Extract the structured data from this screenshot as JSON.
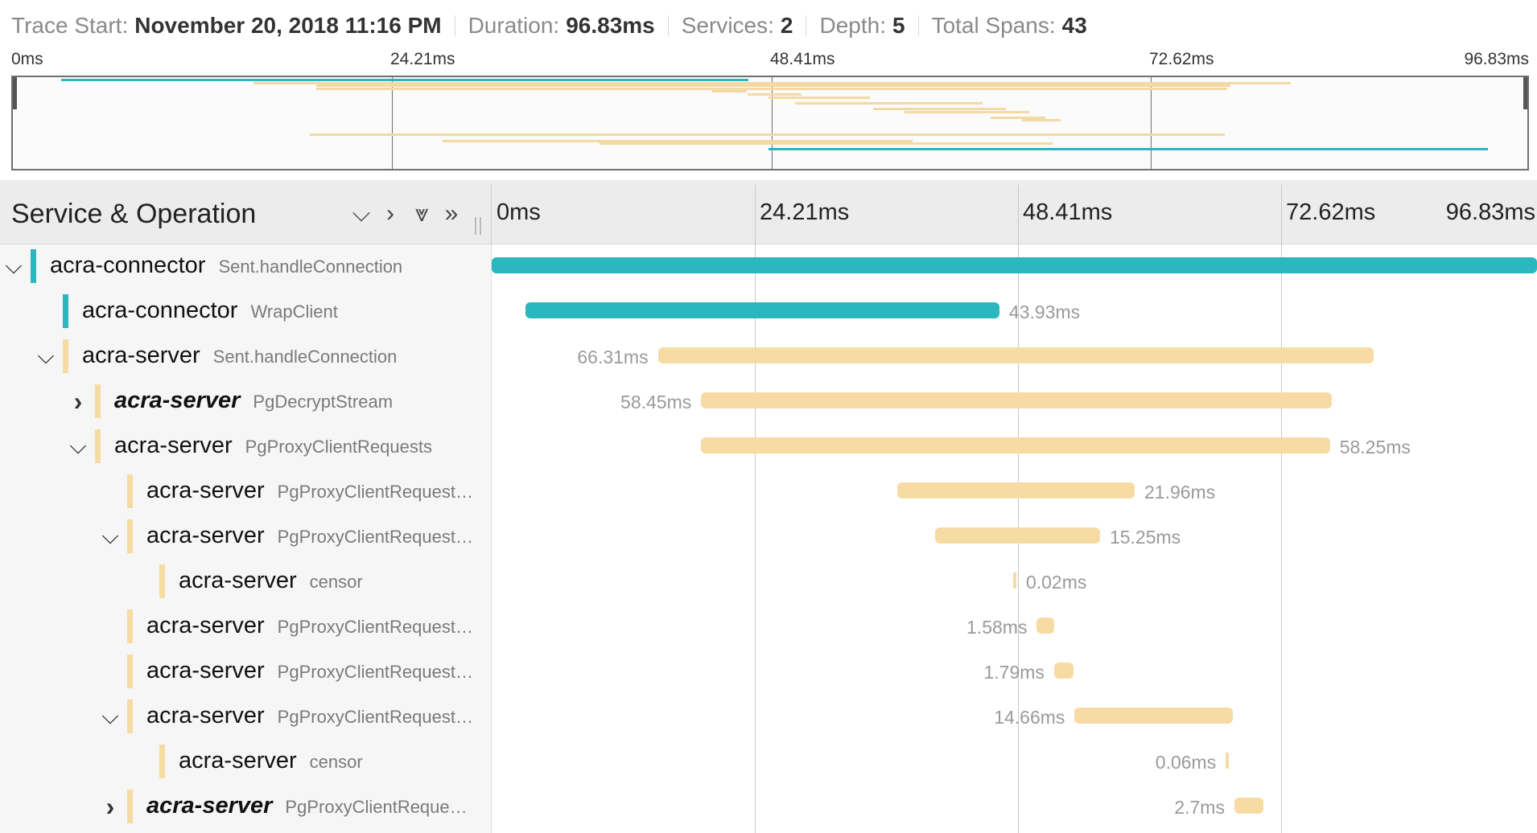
{
  "header": {
    "trace_start_label": "Trace Start:",
    "trace_start_value": "November 20, 2018 11:16 PM",
    "duration_label": "Duration:",
    "duration_value": "96.83ms",
    "services_label": "Services:",
    "services_value": "2",
    "depth_label": "Depth:",
    "depth_value": "5",
    "total_spans_label": "Total Spans:",
    "total_spans_value": "43"
  },
  "ticks": [
    "0ms",
    "24.21ms",
    "48.41ms",
    "72.62ms",
    "96.83ms"
  ],
  "colors": {
    "connector": "#2ab7bd",
    "server": "#f6dba3",
    "server_mini": "#f3d9a4"
  },
  "table": {
    "title": "Service & Operation",
    "controls": [
      "collapse-one",
      "expand-one",
      "collapse-all",
      "expand-all"
    ],
    "control_glyphs": [
      "⌵",
      "›",
      "⩔",
      "»"
    ]
  },
  "rows": [
    {
      "service": "acra-connector",
      "operation": "Sent.handleConnection",
      "depth": 0,
      "toggle": "open",
      "color": "connector",
      "start": 0.0,
      "duration": 96.83,
      "label": "",
      "label_side": "none",
      "emphasis": false
    },
    {
      "service": "acra-connector",
      "operation": "WrapClient",
      "depth": 1,
      "toggle": "none",
      "color": "connector",
      "start": 3.1,
      "duration": 43.93,
      "label": "43.93ms",
      "label_side": "right",
      "emphasis": false
    },
    {
      "service": "acra-server",
      "operation": "Sent.handleConnection",
      "depth": 1,
      "toggle": "open",
      "color": "server",
      "start": 15.4,
      "duration": 66.31,
      "label": "66.31ms",
      "label_side": "left",
      "emphasis": false
    },
    {
      "service": "acra-server",
      "operation": "PgDecryptStream",
      "depth": 2,
      "toggle": "closed",
      "color": "server",
      "start": 19.4,
      "duration": 58.45,
      "label": "58.45ms",
      "label_side": "left",
      "emphasis": true
    },
    {
      "service": "acra-server",
      "operation": "PgProxyClientRequests",
      "depth": 2,
      "toggle": "open",
      "color": "server",
      "start": 19.4,
      "duration": 58.25,
      "label": "58.25ms",
      "label_side": "right",
      "emphasis": false
    },
    {
      "service": "acra-server",
      "operation": "PgProxyClientRequest…",
      "depth": 3,
      "toggle": "none",
      "color": "server",
      "start": 37.6,
      "duration": 21.96,
      "label": "21.96ms",
      "label_side": "right",
      "emphasis": false
    },
    {
      "service": "acra-server",
      "operation": "PgProxyClientRequest…",
      "depth": 3,
      "toggle": "open",
      "color": "server",
      "start": 41.1,
      "duration": 15.25,
      "label": "15.25ms",
      "label_side": "right",
      "emphasis": false
    },
    {
      "service": "acra-server",
      "operation": "censor",
      "depth": 4,
      "toggle": "none",
      "color": "server",
      "start": 48.3,
      "duration": 0.02,
      "label": "0.02ms",
      "label_side": "right",
      "emphasis": false
    },
    {
      "service": "acra-server",
      "operation": "PgProxyClientRequest…",
      "depth": 3,
      "toggle": "none",
      "color": "server",
      "start": 50.5,
      "duration": 1.58,
      "label": "1.58ms",
      "label_side": "left",
      "emphasis": false
    },
    {
      "service": "acra-server",
      "operation": "PgProxyClientRequest…",
      "depth": 3,
      "toggle": "none",
      "color": "server",
      "start": 52.1,
      "duration": 1.79,
      "label": "1.79ms",
      "label_side": "left",
      "emphasis": false
    },
    {
      "service": "acra-server",
      "operation": "PgProxyClientRequest…",
      "depth": 3,
      "toggle": "open",
      "color": "server",
      "start": 54.0,
      "duration": 14.66,
      "label": "14.66ms",
      "label_side": "left",
      "emphasis": false
    },
    {
      "service": "acra-server",
      "operation": "censor",
      "depth": 4,
      "toggle": "none",
      "color": "server",
      "start": 68.0,
      "duration": 0.06,
      "label": "0.06ms",
      "label_side": "left",
      "emphasis": false
    },
    {
      "service": "acra-server",
      "operation": "PgProxyClientReque…",
      "depth": 3,
      "toggle": "closed",
      "color": "server",
      "start": 68.8,
      "duration": 2.7,
      "label": "2.7ms",
      "label_side": "left",
      "emphasis": true
    }
  ],
  "minimap": {
    "total": 96.83,
    "spans": [
      {
        "start": 3.1,
        "duration": 43.93,
        "color": "connector",
        "lane": 0
      },
      {
        "start": 15.4,
        "duration": 66.31,
        "color": "server",
        "lane": 1
      },
      {
        "start": 19.4,
        "duration": 58.45,
        "color": "server",
        "lane": 2
      },
      {
        "start": 19.4,
        "duration": 58.25,
        "color": "server",
        "lane": 3
      },
      {
        "start": 44.7,
        "duration": 2.2,
        "color": "server",
        "lane": 4
      },
      {
        "start": 47.0,
        "duration": 3.4,
        "color": "server",
        "lane": 5
      },
      {
        "start": 48.3,
        "duration": 6.5,
        "color": "server",
        "lane": 6
      },
      {
        "start": 50.0,
        "duration": 12.0,
        "color": "server",
        "lane": 8
      },
      {
        "start": 55.0,
        "duration": 8.5,
        "color": "server",
        "lane": 10
      },
      {
        "start": 57.0,
        "duration": 8.0,
        "color": "server",
        "lane": 11
      },
      {
        "start": 62.5,
        "duration": 3.5,
        "color": "server",
        "lane": 13
      },
      {
        "start": 64.5,
        "duration": 2.5,
        "color": "server",
        "lane": 14
      },
      {
        "start": 19.0,
        "duration": 58.5,
        "color": "server",
        "lane": 19
      },
      {
        "start": 27.5,
        "duration": 30.0,
        "color": "server",
        "lane": 21
      },
      {
        "start": 37.5,
        "duration": 29.0,
        "color": "server",
        "lane": 22
      },
      {
        "start": 48.3,
        "duration": 46.0,
        "color": "connector",
        "lane": 24
      }
    ]
  }
}
